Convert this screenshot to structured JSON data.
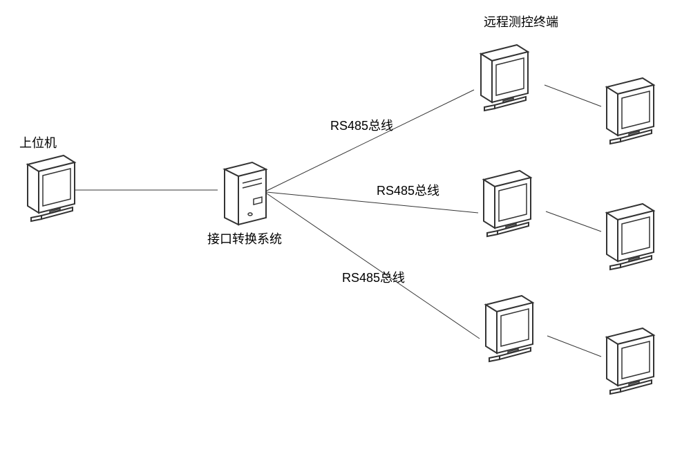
{
  "labels": {
    "host": "上位机",
    "converter": "接口转换系统",
    "terminal_header": "远程测控终端",
    "bus1": "RS485总线",
    "bus2": "RS485总线",
    "bus3": "RS485总线"
  }
}
